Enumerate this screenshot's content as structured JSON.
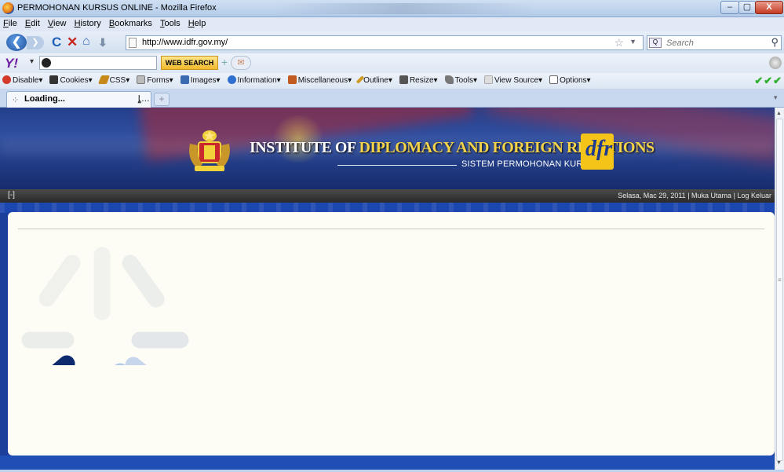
{
  "window": {
    "title": "PERMOHONAN KURSUS ONLINE - Mozilla Firefox",
    "min_glyph": "–",
    "max_glyph": "▢",
    "close_glyph": "X"
  },
  "menu": [
    "File",
    "Edit",
    "View",
    "History",
    "Bookmarks",
    "Tools",
    "Help"
  ],
  "nav": {
    "back_glyph": "❮",
    "forward_glyph": "❯",
    "url": "http://www.idfr.gov.my/",
    "search_placeholder": "Search"
  },
  "yahoo_toolbar": {
    "logo": "Y!",
    "search_button": "WEB SEARCH"
  },
  "dev_toolbar": {
    "items": [
      {
        "label": "Disable▾",
        "color": "#d23a2a"
      },
      {
        "label": "Cookies▾",
        "color": "#333333"
      },
      {
        "label": "CSS▾",
        "color": "#c78a1a"
      },
      {
        "label": "Forms▾",
        "color": "#8a8a8a"
      },
      {
        "label": "Images▾",
        "color": "#3a6ab0"
      },
      {
        "label": "Information▾",
        "color": "#2f6fd0"
      },
      {
        "label": "Miscellaneous▾",
        "color": "#c05a20"
      },
      {
        "label": "Outline▾",
        "color": "#d09a20"
      },
      {
        "label": "Resize▾",
        "color": "#555555"
      },
      {
        "label": "Tools▾",
        "color": "#777777"
      },
      {
        "label": "View Source▾",
        "color": "#aaaaaa"
      },
      {
        "label": "Options▾",
        "color": "#666666"
      }
    ],
    "status_checks": "✔✔✔"
  },
  "tabs": [
    {
      "label": "Loading...",
      "active": true
    }
  ],
  "page": {
    "institute_plain": "INSTITUTE OF",
    "institute_gold": "DIPLOMACY AND FOREIGN RELATIONS",
    "subtitle": "SISTEM PERMOHONAN KURSUS",
    "logo_text": "dfr",
    "collapse_toggle": "[-]",
    "date": "Selasa, Mac 29, 2011",
    "separator": "|",
    "links": [
      "Muka Utama",
      "Log Keluar"
    ]
  },
  "colors": {
    "banner": "#233f8c",
    "accent_gold": "#f3d34a",
    "content_bg": "#fdfdf6",
    "spinner_dark": "#0d2a6e",
    "spinner_mid": "#3a7bd5",
    "spinner_light": "#dfe6f0"
  }
}
